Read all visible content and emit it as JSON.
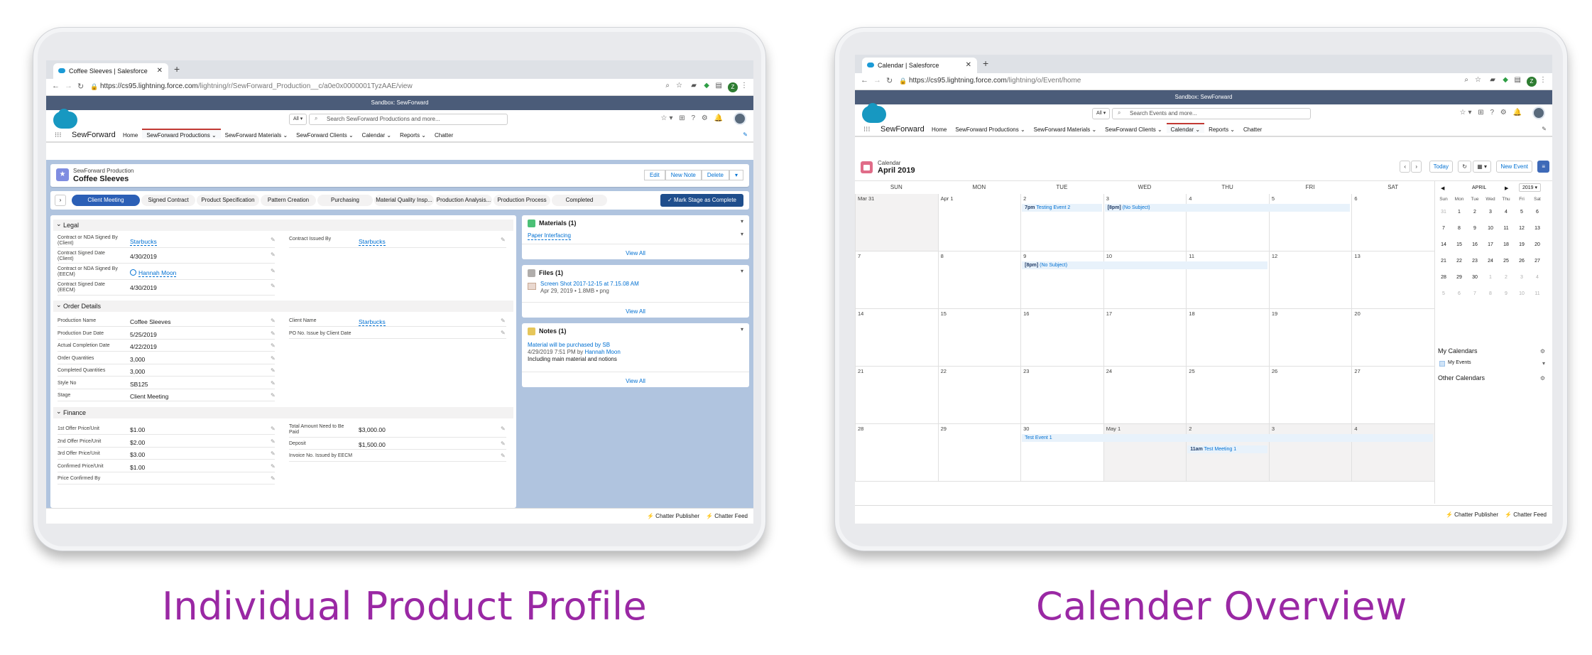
{
  "left_caption": "Individual Product Profile",
  "right_caption": "Calender Overview",
  "left": {
    "tab_title": "Coffee Sleeves | Salesforce",
    "url_host": "https://cs95.lightning.force.com",
    "url_path": "/lightning/r/SewForward_Production__c/a0e0x0000001TyzAAE/view",
    "profile_initial": "Z",
    "sandbox": "Sandbox: SewForward",
    "search_scope": "All ▾",
    "search_placeholder": "Search SewForward Productions and more...",
    "app_name": "SewForward",
    "nav": [
      "Home",
      "SewForward Productions ⌄",
      "SewForward Materials ⌄",
      "SewForward Clients ⌄",
      "Calendar ⌄",
      "Reports ⌄",
      "Chatter"
    ],
    "record_type": "SewForward Production",
    "record_name": "Coffee Sleeves",
    "buttons": [
      "Edit",
      "New Note",
      "Delete",
      "▾"
    ],
    "path": [
      "Client Meeting",
      "Signed Contract",
      "Product Specification",
      "Pattern Creation",
      "Purchasing",
      "Material Quality Insp...",
      "Production Analysis...",
      "Production Process",
      "Completed"
    ],
    "mark_stage": "✓ Mark Stage as Complete",
    "sections": {
      "legal": "Legal",
      "order": "Order Details",
      "finance": "Finance"
    },
    "legal_fields": [
      {
        "label": "Contract or NDA Signed By (Client)",
        "value": "Starbucks"
      },
      {
        "label": "Contract Signed Date (Client)",
        "value": "4/30/2019"
      },
      {
        "label": "Contract or NDA Signed By (EECM)",
        "value": "Hannah Moon"
      },
      {
        "label": "Contract Signed Date (EECM)",
        "value": "4/30/2019"
      }
    ],
    "legal_right": {
      "label": "Contract Issued By",
      "value": "Starbucks"
    },
    "order_fields": [
      {
        "label": "Production Name",
        "value": "Coffee Sleeves"
      },
      {
        "label": "Production Due Date",
        "value": "5/25/2019"
      },
      {
        "label": "Actual Completion Date",
        "value": "4/22/2019"
      },
      {
        "label": "Order Quantities",
        "value": "3,000"
      },
      {
        "label": "Completed Quantities",
        "value": "3,000"
      },
      {
        "label": "Style No",
        "value": "SB125"
      },
      {
        "label": "Stage",
        "value": "Client Meeting"
      }
    ],
    "order_right": [
      {
        "label": "Client Name",
        "value": "Starbucks"
      },
      {
        "label": "PO No. Issue by Client Date",
        "value": ""
      }
    ],
    "finance_fields": [
      {
        "label": "1st Offer Price/Unit",
        "value": "$1.00"
      },
      {
        "label": "2nd Offer Price/Unit",
        "value": "$2.00"
      },
      {
        "label": "3rd Offer Price/Unit",
        "value": "$3.00"
      },
      {
        "label": "Confirmed Price/Unit",
        "value": "$1.00"
      },
      {
        "label": "Price Confirmed By",
        "value": ""
      }
    ],
    "finance_right": [
      {
        "label": "Total Amount Need to Be Paid",
        "value": "$3,000.00"
      },
      {
        "label": "Deposit",
        "value": "$1,500.00"
      },
      {
        "label": "Invoice No. Issued by EECM",
        "value": ""
      }
    ],
    "materials": {
      "title": "Materials (1)",
      "item": "Paper Interfacing",
      "view_all": "View All"
    },
    "files": {
      "title": "Files (1)",
      "item": "Screen Shot 2017-12-15 at 7.15.08 AM",
      "meta": "Apr 29, 2019 • 1.8MB • png",
      "view_all": "View All"
    },
    "notes": {
      "title": "Notes (1)",
      "item": "Material will be purchased by SB",
      "meta_prefix": "4/29/2019 7:51 PM by",
      "meta_author": "Hannah Moon",
      "body": "Including main material and notions",
      "view_all": "View All"
    },
    "footer": [
      "⚡ Chatter Publisher",
      "⚡ Chatter Feed"
    ]
  },
  "right": {
    "tab_title": "Calendar | Salesforce",
    "url_host": "https://cs95.lightning.force.com",
    "url_path": "/lightning/o/Event/home",
    "profile_initial": "Z",
    "sandbox": "Sandbox: SewForward",
    "search_scope": "All ▾",
    "search_placeholder": "Search Events and more...",
    "app_name": "SewForward",
    "nav": [
      "Home",
      "SewForward Productions ⌄",
      "SewForward Materials ⌄",
      "SewForward Clients ⌄",
      "Calendar ⌄",
      "Reports ⌄",
      "Chatter"
    ],
    "cal_type": "Calendar",
    "cal_month": "April 2019",
    "today": "Today",
    "new_event": "New Event",
    "dow": [
      "SUN",
      "MON",
      "TUE",
      "WED",
      "THU",
      "FRI",
      "SAT"
    ],
    "weeks": [
      [
        "Mar 31",
        "Apr 1",
        "2",
        "3",
        "4",
        "5",
        "6"
      ],
      [
        "7",
        "8",
        "9",
        "10",
        "11",
        "12",
        "13"
      ],
      [
        "14",
        "15",
        "16",
        "17",
        "18",
        "19",
        "20"
      ],
      [
        "21",
        "22",
        "23",
        "24",
        "25",
        "26",
        "27"
      ],
      [
        "28",
        "29",
        "30",
        "May 1",
        "2",
        "3",
        "4"
      ]
    ],
    "events": {
      "e1_time": "7pm",
      "e1_title": "Testing Event 2",
      "e2_time": "[8pm]",
      "e2_title": "(No Subject)",
      "e3_time": "[8pm]",
      "e3_title": "(No Subject)",
      "e4_title": "Test Event 1",
      "e5_time": "11am",
      "e5_title": "Test Meeting 1"
    },
    "mini": {
      "month": "APRIL",
      "year": "2019 ▾",
      "heads": [
        "Sun",
        "Mon",
        "Tue",
        "Wed",
        "Thu",
        "Fri",
        "Sat"
      ],
      "rows": [
        [
          "31",
          "1",
          "2",
          "3",
          "4",
          "5",
          "6"
        ],
        [
          "7",
          "8",
          "9",
          "10",
          "11",
          "12",
          "13"
        ],
        [
          "14",
          "15",
          "16",
          "17",
          "18",
          "19",
          "20"
        ],
        [
          "21",
          "22",
          "23",
          "24",
          "25",
          "26",
          "27"
        ],
        [
          "28",
          "29",
          "30",
          "1",
          "2",
          "3",
          "4"
        ],
        [
          "5",
          "6",
          "7",
          "8",
          "9",
          "10",
          "11"
        ]
      ]
    },
    "my_calendars": "My Calendars",
    "my_events": "My Events",
    "other_calendars": "Other Calendars",
    "footer": [
      "⚡ Chatter Publisher",
      "⚡ Chatter Feed"
    ]
  }
}
